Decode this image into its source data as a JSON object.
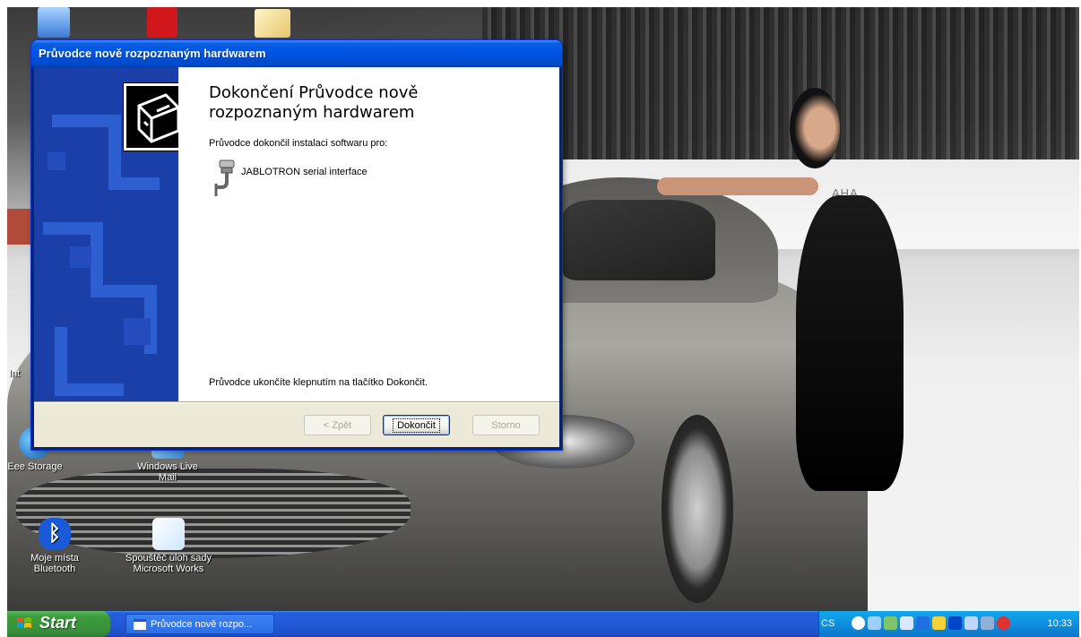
{
  "desktop": {
    "icons": [
      {
        "label": "Eee Storage"
      },
      {
        "label": "Windows Live Mail"
      },
      {
        "label": "Moje místa Bluetooth"
      },
      {
        "label": "Spouštěč úloh sady Microsoft Works"
      }
    ],
    "partial_text_left": "Int",
    "wallpaper_brand_text": "AHA"
  },
  "dialog": {
    "title": "Průvodce nově rozpoznaným hardwarem",
    "heading": "Dokončení Průvodce nově rozpoznaným hardwarem",
    "subtitle": "Průvodce dokončil instalaci softwaru pro:",
    "device_name": "JABLOTRON serial interface",
    "device_icon": "serial-port-icon",
    "hardware_icon": "hardware-wizard-icon",
    "finish_hint": "Průvodce ukončíte klepnutím na tlačítko Dokončit.",
    "buttons": {
      "back": "< Zpět",
      "finish": "Dokončit",
      "cancel": "Storno"
    }
  },
  "taskbar": {
    "start_label": "Start",
    "tasks": [
      {
        "label": "Průvodce nově rozpo..."
      }
    ],
    "language": "CS",
    "clock": "10:33"
  }
}
